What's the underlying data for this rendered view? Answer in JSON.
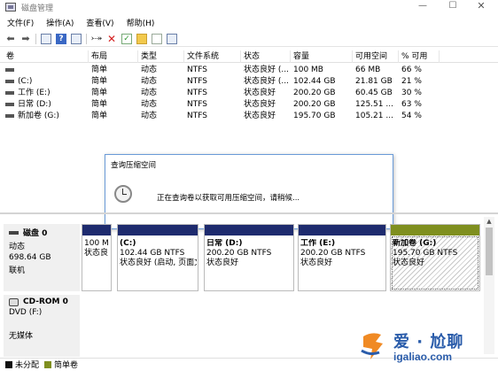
{
  "window": {
    "title": "磁盘管理",
    "controls": {
      "minimize": "—",
      "maximize": "☐",
      "close": "✕"
    }
  },
  "menu": [
    "文件(F)",
    "操作(A)",
    "查看(V)",
    "帮助(H)"
  ],
  "toolbar_icons": [
    "back-arrow-icon",
    "forward-arrow-icon",
    "disk-list-icon",
    "help-icon",
    "properties-icon",
    "connect-icon",
    "delete-icon",
    "check-icon",
    "folder-icon",
    "document-icon",
    "settings-list-icon"
  ],
  "volumes": {
    "columns": [
      "卷",
      "布局",
      "类型",
      "文件系统",
      "状态",
      "容量",
      "可用空间",
      "% 可用"
    ],
    "rows": [
      {
        "name": "",
        "layout": "简单",
        "type": "动态",
        "fs": "NTFS",
        "status": "状态良好 (...",
        "capacity": "100 MB",
        "free": "66 MB",
        "pct": "66 %"
      },
      {
        "name": "(C:)",
        "layout": "简单",
        "type": "动态",
        "fs": "NTFS",
        "status": "状态良好 (...",
        "capacity": "102.44 GB",
        "free": "21.81 GB",
        "pct": "21 %"
      },
      {
        "name": "工作 (E:)",
        "layout": "简单",
        "type": "动态",
        "fs": "NTFS",
        "status": "状态良好",
        "capacity": "200.20 GB",
        "free": "60.45 GB",
        "pct": "30 %"
      },
      {
        "name": "日常 (D:)",
        "layout": "简单",
        "type": "动态",
        "fs": "NTFS",
        "status": "状态良好",
        "capacity": "200.20 GB",
        "free": "125.51 ...",
        "pct": "63 %"
      },
      {
        "name": "新加卷 (G:)",
        "layout": "简单",
        "type": "动态",
        "fs": "NTFS",
        "status": "状态良好",
        "capacity": "195.70 GB",
        "free": "105.21 ...",
        "pct": "54 %"
      }
    ]
  },
  "dialog": {
    "title": "查询压缩空间",
    "message": "正在查询卷以获取可用压缩空间，请稍候..."
  },
  "disk0": {
    "name": "磁盘 0",
    "type": "动态",
    "size": "698.64 GB",
    "state": "联机",
    "partitions": [
      {
        "name": "",
        "line1": "100 M",
        "line2": "状态良"
      },
      {
        "name": "(C:)",
        "line1": "102.44 GB NTFS",
        "line2": "状态良好 (启动, 页面文"
      },
      {
        "name": "日常  (D:)",
        "line1": "200.20 GB NTFS",
        "line2": "状态良好"
      },
      {
        "name": "工作  (E:)",
        "line1": "200.20 GB NTFS",
        "line2": "状态良好"
      },
      {
        "name": "新加卷  (G:)",
        "line1": "195.70 GB NTFS",
        "line2": "状态良好"
      }
    ]
  },
  "cdrom": {
    "name": "CD-ROM 0",
    "drive": "DVD (F:)",
    "media": "无媒体"
  },
  "legend": {
    "unallocated": "未分配",
    "simple": "简单卷"
  },
  "colors": {
    "simple_volume": "#7f8f1f",
    "unallocated": "#111111",
    "partition_bar": "#1e2b6e",
    "dialog_border": "#6a9bd8"
  },
  "watermark": {
    "brand": "爱 · 尬聊",
    "url": "igaliao.com"
  }
}
